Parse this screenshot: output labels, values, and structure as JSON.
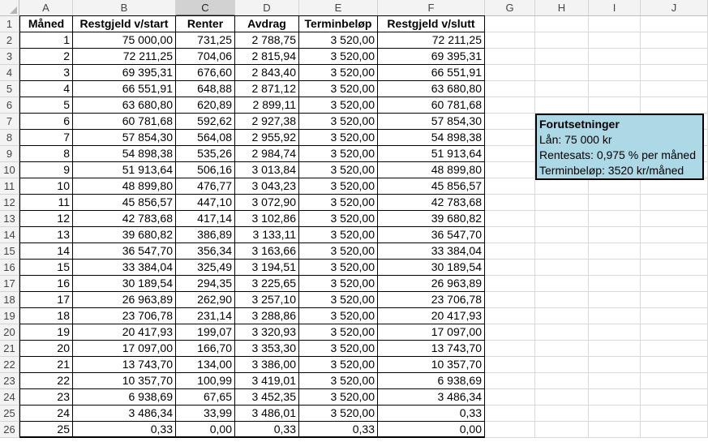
{
  "columns": [
    "A",
    "B",
    "C",
    "D",
    "E",
    "F",
    "G",
    "H",
    "I",
    "J"
  ],
  "selected_column": "C",
  "table": {
    "headers": [
      "Måned",
      "Restgjeld v/start",
      "Renter",
      "Avdrag",
      "Terminbeløp",
      "Restgjeld v/slutt"
    ],
    "rows": [
      [
        "1",
        "75 000,00",
        "731,25",
        "2 788,75",
        "3 520,00",
        "72 211,25"
      ],
      [
        "2",
        "72 211,25",
        "704,06",
        "2 815,94",
        "3 520,00",
        "69 395,31"
      ],
      [
        "3",
        "69 395,31",
        "676,60",
        "2 843,40",
        "3 520,00",
        "66 551,91"
      ],
      [
        "4",
        "66 551,91",
        "648,88",
        "2 871,12",
        "3 520,00",
        "63 680,80"
      ],
      [
        "5",
        "63 680,80",
        "620,89",
        "2 899,11",
        "3 520,00",
        "60 781,68"
      ],
      [
        "6",
        "60 781,68",
        "592,62",
        "2 927,38",
        "3 520,00",
        "57 854,30"
      ],
      [
        "7",
        "57 854,30",
        "564,08",
        "2 955,92",
        "3 520,00",
        "54 898,38"
      ],
      [
        "8",
        "54 898,38",
        "535,26",
        "2 984,74",
        "3 520,00",
        "51 913,64"
      ],
      [
        "9",
        "51 913,64",
        "506,16",
        "3 013,84",
        "3 520,00",
        "48 899,80"
      ],
      [
        "10",
        "48 899,80",
        "476,77",
        "3 043,23",
        "3 520,00",
        "45 856,57"
      ],
      [
        "11",
        "45 856,57",
        "447,10",
        "3 072,90",
        "3 520,00",
        "42 783,68"
      ],
      [
        "12",
        "42 783,68",
        "417,14",
        "3 102,86",
        "3 520,00",
        "39 680,82"
      ],
      [
        "13",
        "39 680,82",
        "386,89",
        "3 133,11",
        "3 520,00",
        "36 547,70"
      ],
      [
        "14",
        "36 547,70",
        "356,34",
        "3 163,66",
        "3 520,00",
        "33 384,04"
      ],
      [
        "15",
        "33 384,04",
        "325,49",
        "3 194,51",
        "3 520,00",
        "30 189,54"
      ],
      [
        "16",
        "30 189,54",
        "294,35",
        "3 225,65",
        "3 520,00",
        "26 963,89"
      ],
      [
        "17",
        "26 963,89",
        "262,90",
        "3 257,10",
        "3 520,00",
        "23 706,78"
      ],
      [
        "18",
        "23 706,78",
        "231,14",
        "3 288,86",
        "3 520,00",
        "20 417,93"
      ],
      [
        "19",
        "20 417,93",
        "199,07",
        "3 320,93",
        "3 520,00",
        "17 097,00"
      ],
      [
        "20",
        "17 097,00",
        "166,70",
        "3 353,30",
        "3 520,00",
        "13 743,70"
      ],
      [
        "21",
        "13 743,70",
        "134,00",
        "3 386,00",
        "3 520,00",
        "10 357,70"
      ],
      [
        "22",
        "10 357,70",
        "100,99",
        "3 419,01",
        "3 520,00",
        "6 938,69"
      ],
      [
        "23",
        "6 938,69",
        "67,65",
        "3 452,35",
        "3 520,00",
        "3 486,34"
      ],
      [
        "24",
        "3 486,34",
        "33,99",
        "3 486,01",
        "3 520,00",
        "0,33"
      ],
      [
        "25",
        "0,33",
        "0,00",
        "0,33",
        "0,33",
        "0,00"
      ]
    ]
  },
  "info_box": {
    "title": "Forutsetninger",
    "lines": [
      "Lån: 75 000 kr",
      "Rentesats: 0,975 % per måned",
      "Terminbeløp: 3520 kr/måned"
    ],
    "background": "#add8e6"
  }
}
